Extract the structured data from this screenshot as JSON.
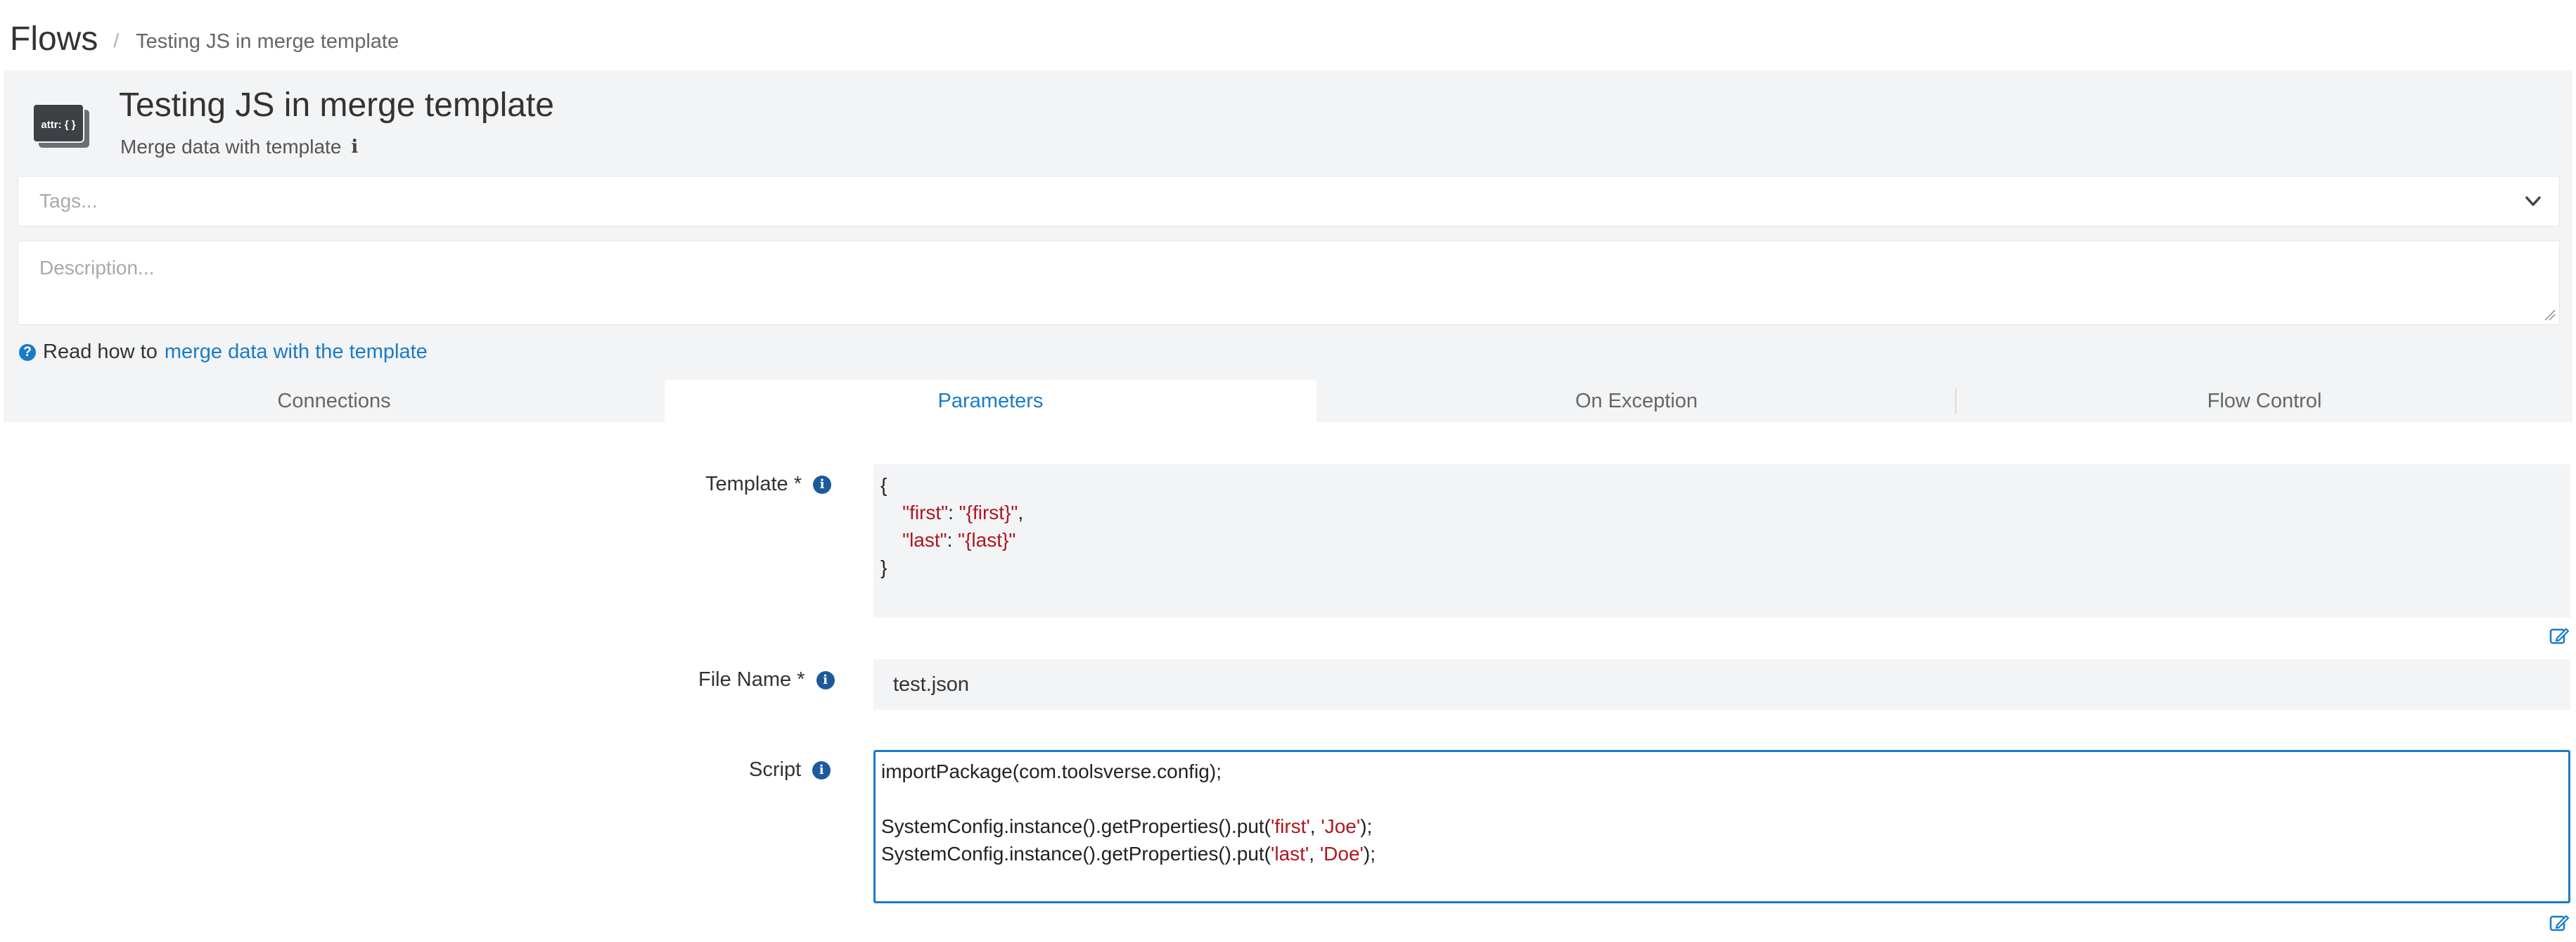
{
  "breadcrumb": {
    "root": "Flows",
    "separator": "/",
    "current": "Testing JS in merge template"
  },
  "header": {
    "icon_label": "attr: { }",
    "title": "Testing JS in merge template",
    "subtitle": "Merge data with template",
    "info_icon": "info-icon"
  },
  "tags": {
    "placeholder": "Tags..."
  },
  "description": {
    "placeholder": "Description..."
  },
  "help": {
    "prefix": "Read how to",
    "link": "merge data with the template"
  },
  "tabs": [
    {
      "label": "Connections",
      "active": false
    },
    {
      "label": "Parameters",
      "active": true
    },
    {
      "label": "On Exception",
      "active": false
    },
    {
      "label": "Flow Control",
      "active": false
    }
  ],
  "form": {
    "template": {
      "label": "Template *",
      "lines": [
        {
          "plain": "{"
        },
        {
          "indent": "    ",
          "key": "\"first\"",
          "colon": ": ",
          "value": "\"{first}\"",
          "tail": ","
        },
        {
          "indent": "    ",
          "key": "\"last\"",
          "colon": ": ",
          "value": "\"{last}\"",
          "tail": ""
        },
        {
          "plain": "}"
        }
      ]
    },
    "file_name": {
      "label": "File Name *",
      "value": "test.json"
    },
    "script": {
      "label": "Script",
      "line1": "importPackage(com.toolsverse.config);",
      "line3_pre": "SystemConfig.instance().getProperties().put(",
      "line3_a": "'first'",
      "line3_mid": ", ",
      "line3_b": "'Joe'",
      "line3_post": ");",
      "line4_pre": "SystemConfig.instance().getProperties().put(",
      "line4_a": "'last'",
      "line4_mid": ", ",
      "line4_b": "'Doe'",
      "line4_post": ");"
    }
  },
  "colors": {
    "accent": "#1a7bc7",
    "string": "#b0161f",
    "panel_bg": "#f3f4f6",
    "info_icon": "#1c5a9c"
  }
}
